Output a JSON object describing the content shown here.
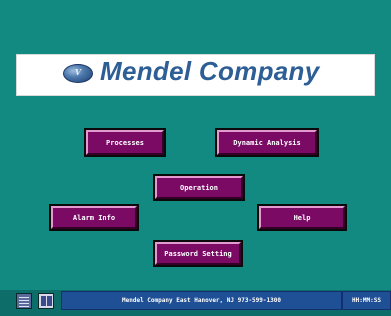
{
  "banner": {
    "logo_mark": "V",
    "company_name": "Mendel Company"
  },
  "buttons": {
    "processes": "Processes",
    "dynamic_analysis": "Dynamic Analysis",
    "operation": "Operation",
    "alarm_info": "Alarm Info",
    "help": "Help",
    "password_setting": "Password Setting"
  },
  "taskbar": {
    "menu_icon": "menu-icon",
    "book_icon": "book-icon",
    "status_text": "Mendel Company East Hanover, NJ 973-599-1300",
    "clock": "HH:MM:SS"
  },
  "colors": {
    "background": "#138a81",
    "button": "#7a0a64",
    "logo_text": "#2d5e96",
    "status_bar": "#1f4f95"
  }
}
